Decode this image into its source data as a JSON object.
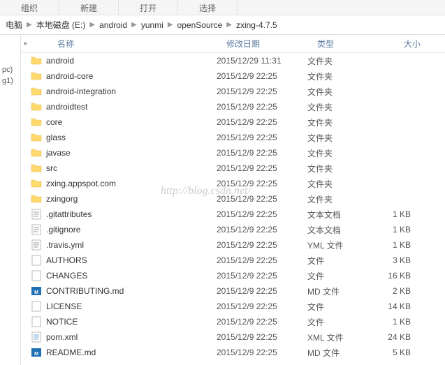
{
  "toolbar": {
    "items": [
      "组织",
      "新建",
      "打开",
      "选择"
    ]
  },
  "breadcrumb": {
    "items": [
      "电脑",
      "本地磁盘 (E:)",
      "android",
      "yunmi",
      "openSource",
      "zxing-4.7.5"
    ]
  },
  "sidebar": {
    "lines": [
      "",
      "",
      "",
      "",
      "",
      "",
      "",
      "",
      "",
      "pc)",
      "g1)"
    ]
  },
  "headers": {
    "name": "名称",
    "date": "修改日期",
    "type": "类型",
    "size": "大小"
  },
  "files": [
    {
      "icon": "folder",
      "name": "android",
      "date": "2015/12/29 11:31",
      "type": "文件夹",
      "size": ""
    },
    {
      "icon": "folder",
      "name": "android-core",
      "date": "2015/12/9 22:25",
      "type": "文件夹",
      "size": ""
    },
    {
      "icon": "folder",
      "name": "android-integration",
      "date": "2015/12/9 22:25",
      "type": "文件夹",
      "size": ""
    },
    {
      "icon": "folder",
      "name": "androidtest",
      "date": "2015/12/9 22:25",
      "type": "文件夹",
      "size": ""
    },
    {
      "icon": "folder",
      "name": "core",
      "date": "2015/12/9 22:25",
      "type": "文件夹",
      "size": ""
    },
    {
      "icon": "folder",
      "name": "glass",
      "date": "2015/12/9 22:25",
      "type": "文件夹",
      "size": ""
    },
    {
      "icon": "folder",
      "name": "javase",
      "date": "2015/12/9 22:25",
      "type": "文件夹",
      "size": ""
    },
    {
      "icon": "folder",
      "name": "src",
      "date": "2015/12/9 22:25",
      "type": "文件夹",
      "size": ""
    },
    {
      "icon": "folder",
      "name": "zxing.appspot.com",
      "date": "2015/12/9 22:25",
      "type": "文件夹",
      "size": ""
    },
    {
      "icon": "folder",
      "name": "zxingorg",
      "date": "2015/12/9 22:25",
      "type": "文件夹",
      "size": ""
    },
    {
      "icon": "text",
      "name": ".gitattributes",
      "date": "2015/12/9 22:25",
      "type": "文本文档",
      "size": "1 KB"
    },
    {
      "icon": "text",
      "name": ".gitignore",
      "date": "2015/12/9 22:25",
      "type": "文本文档",
      "size": "1 KB"
    },
    {
      "icon": "text",
      "name": ".travis.yml",
      "date": "2015/12/9 22:25",
      "type": "YML 文件",
      "size": "1 KB"
    },
    {
      "icon": "file",
      "name": "AUTHORS",
      "date": "2015/12/9 22:25",
      "type": "文件",
      "size": "3 KB"
    },
    {
      "icon": "file",
      "name": "CHANGES",
      "date": "2015/12/9 22:25",
      "type": "文件",
      "size": "16 KB"
    },
    {
      "icon": "md",
      "name": "CONTRIBUTING.md",
      "date": "2015/12/9 22:25",
      "type": "MD 文件",
      "size": "2 KB"
    },
    {
      "icon": "file",
      "name": "LICENSE",
      "date": "2015/12/9 22:25",
      "type": "文件",
      "size": "14 KB"
    },
    {
      "icon": "file",
      "name": "NOTICE",
      "date": "2015/12/9 22:25",
      "type": "文件",
      "size": "1 KB"
    },
    {
      "icon": "xml",
      "name": "pom.xml",
      "date": "2015/12/9 22:25",
      "type": "XML 文件",
      "size": "24 KB"
    },
    {
      "icon": "md",
      "name": "README.md",
      "date": "2015/12/9 22:25",
      "type": "MD 文件",
      "size": "5 KB"
    }
  ],
  "watermark": "http://blog.csdn.net/"
}
